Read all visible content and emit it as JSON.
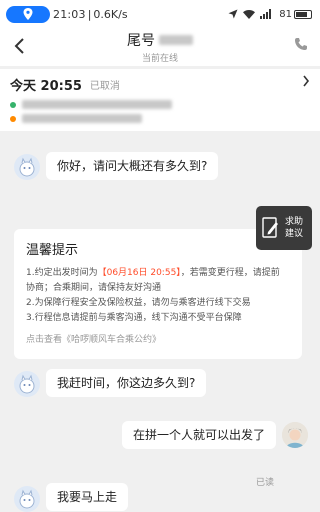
{
  "status_bar": {
    "time": "21:03",
    "speed": "0.6K/s",
    "battery": "81"
  },
  "header": {
    "title_prefix": "尾号",
    "subtitle": "当前在线"
  },
  "order": {
    "date": "今天 20:55",
    "status": "已取消"
  },
  "chat": {
    "messages": [
      {
        "from": "driver",
        "text": "你好，请问大概还有多久到?"
      },
      {
        "from": "driver",
        "text": "我赶时间，你这边多久到?"
      },
      {
        "from": "me",
        "text": "在拼一个人就可以出发了",
        "read": "已读"
      },
      {
        "from": "driver",
        "text": "我要马上走"
      }
    ],
    "tips": {
      "title": "温馨提示",
      "item1_prefix": "1.约定出发时间为",
      "item1_time": "【06月16日 20:55】",
      "item1_suffix": "，若需变更行程，请提前",
      "item1_line2": "协商；合乘期间，请保持友好沟通",
      "item2": "2.为保障行程安全及保险权益，请勿与乘客进行线下交易",
      "item3": "3.行程信息请提前与乘客沟通，线下沟通不受平台保障",
      "link": "点击查看《哈啰顺风车合乘公约》"
    }
  },
  "help_button": {
    "line1": "求助",
    "line2": "建议"
  },
  "colors": {
    "accent": "#1677ff",
    "highlight": "#ff4c2a",
    "start_dot": "#36b26b",
    "end_dot": "#ff8a00"
  }
}
